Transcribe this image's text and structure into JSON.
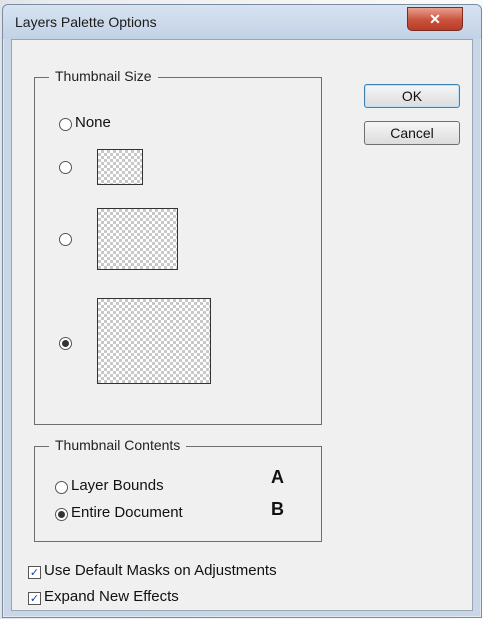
{
  "window": {
    "title": "Layers Palette Options",
    "close_glyph": "✕"
  },
  "buttons": {
    "ok": "OK",
    "cancel": "Cancel"
  },
  "thumbnail_size": {
    "legend": "Thumbnail Size",
    "none_label": "None",
    "selected": "large"
  },
  "thumbnail_contents": {
    "legend": "Thumbnail Contents",
    "layer_bounds": "Layer Bounds",
    "entire_document": "Entire Document",
    "selected": "entire_document",
    "marker_a": "A",
    "marker_b": "B"
  },
  "options": {
    "use_default_masks": {
      "label": "Use Default Masks on Adjustments",
      "checked": true
    },
    "expand_new_effects": {
      "label": "Expand New Effects",
      "checked": true
    }
  },
  "colors": {
    "titlebar": "#c9d6e5",
    "close_button": "#c9523c",
    "checkmark": "#1a3fa8"
  }
}
